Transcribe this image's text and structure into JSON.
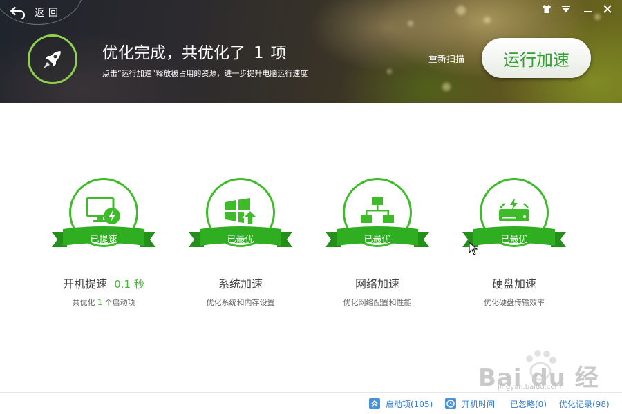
{
  "header": {
    "back_label": "返回",
    "headline_prefix": "优化完成，共优化了",
    "headline_count": "1",
    "headline_suffix": "项",
    "subline": "点击“运行加速”释放被占用的资源，进一步提升电脑运行速度",
    "rescan_label": "重新扫描",
    "run_label": "运行加速"
  },
  "window_controls": [
    "skin-icon",
    "menu-icon",
    "minimize-icon",
    "close-icon"
  ],
  "cards": [
    {
      "icon": "monitor-lightning-icon",
      "badge": "已提速",
      "title": "开机提速",
      "time": "0.1 秒",
      "desc_prefix": "共优化",
      "desc_count": "1",
      "desc_suffix": "个启动项"
    },
    {
      "icon": "windows-upgrade-icon",
      "badge": "已最优",
      "title": "系统加速",
      "desc": "优化系统和内存设置"
    },
    {
      "icon": "network-icon",
      "badge": "已最优",
      "title": "网络加速",
      "desc": "优化网络配置和性能"
    },
    {
      "icon": "harddisk-icon",
      "badge": "已最优",
      "title": "硬盘加速",
      "desc": "优化硬盘传输效率"
    }
  ],
  "footer": {
    "startup_items": "启动项(105)",
    "boot_time": "开机时间",
    "ignored": "已忽略(0)",
    "history": "优化记录(98)"
  },
  "watermark": {
    "text": "Bai du 经验",
    "url": "jingyan.baidu.com"
  },
  "colors": {
    "accent": "#3dbb28",
    "ribbon": "#2fae22",
    "link": "#2d7ecf"
  }
}
